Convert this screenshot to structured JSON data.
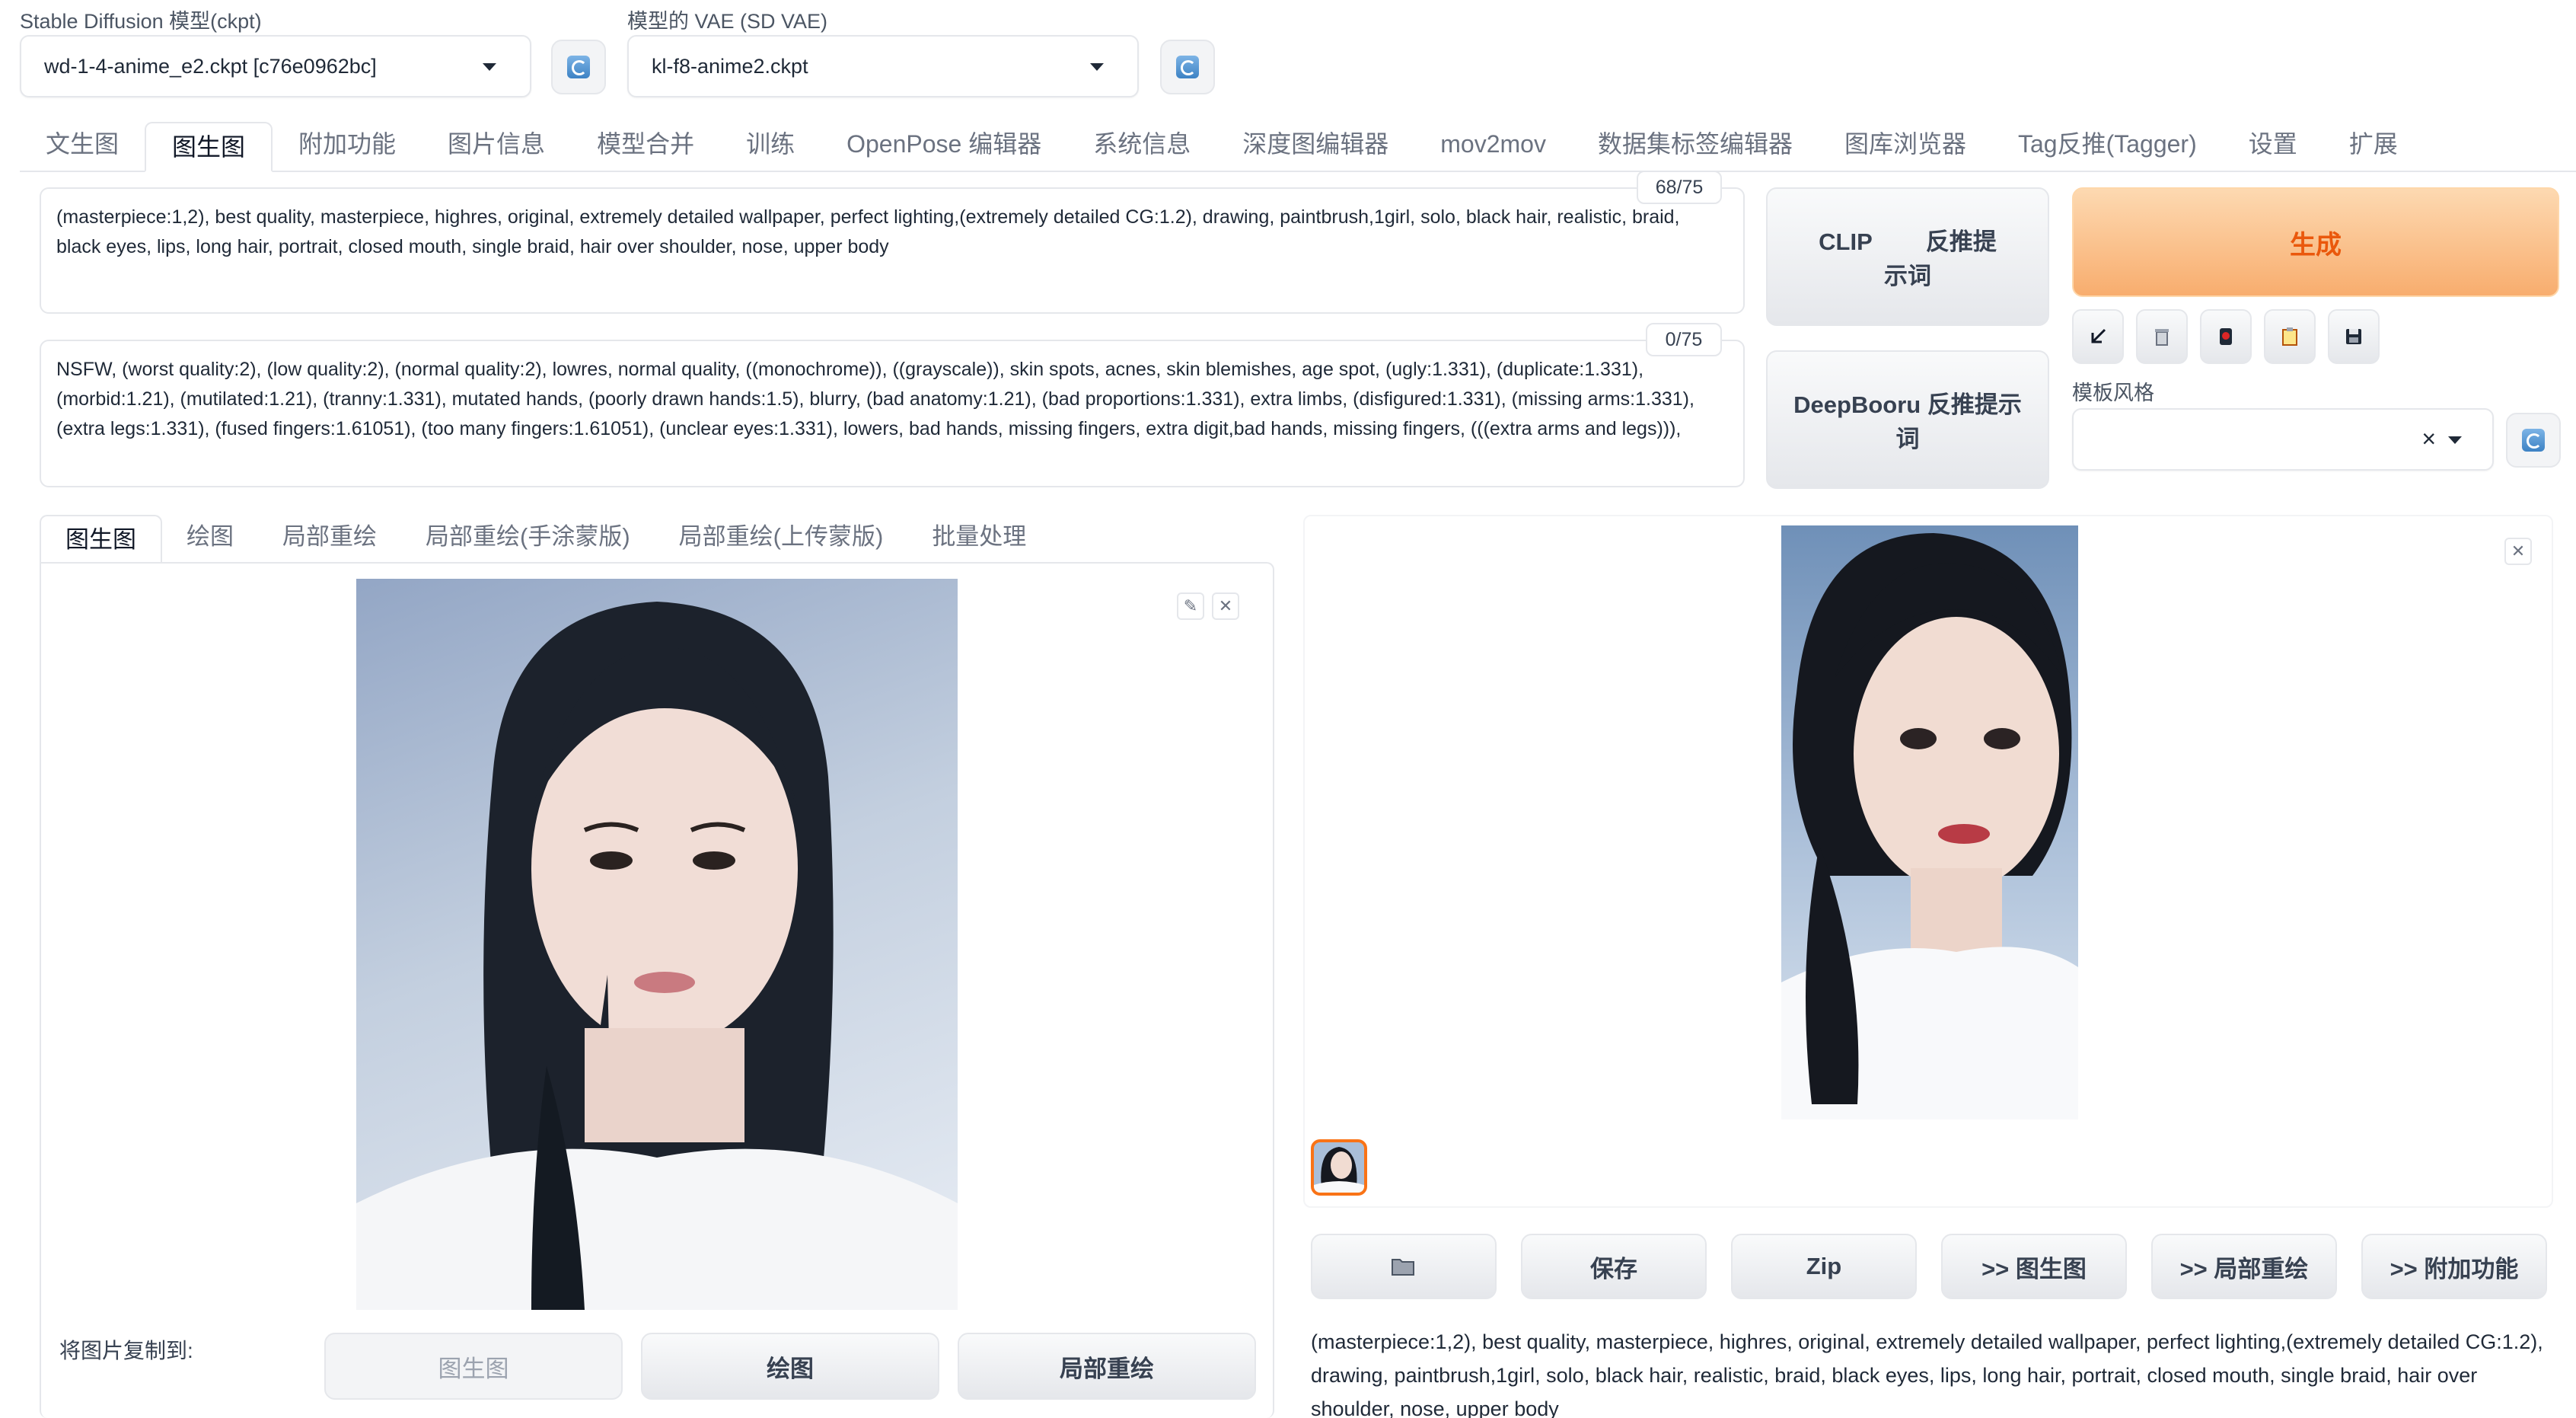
{
  "ckpt": {
    "label": "Stable Diffusion 模型(ckpt)",
    "value": "wd-1-4-anime_e2.ckpt [c76e0962bc]"
  },
  "vae": {
    "label": "模型的 VAE (SD VAE)",
    "value": "kl-f8-anime2.ckpt"
  },
  "tabs": [
    {
      "label": "文生图"
    },
    {
      "label": "图生图"
    },
    {
      "label": "附加功能"
    },
    {
      "label": "图片信息"
    },
    {
      "label": "模型合并"
    },
    {
      "label": "训练"
    },
    {
      "label": "OpenPose 编辑器"
    },
    {
      "label": "系统信息"
    },
    {
      "label": "深度图编辑器"
    },
    {
      "label": "mov2mov"
    },
    {
      "label": "数据集标签编辑器"
    },
    {
      "label": "图库浏览器"
    },
    {
      "label": "Tag反推(Tagger)"
    },
    {
      "label": "设置"
    },
    {
      "label": "扩展"
    }
  ],
  "active_tab": "图生图",
  "prompt": {
    "text": "(masterpiece:1,2), best quality, masterpiece, highres, original, extremely detailed wallpaper, perfect lighting,(extremely detailed CG:1.2), drawing, paintbrush,1girl, solo, black hair, realistic, braid, black eyes, lips, long hair, portrait, closed mouth, single braid, hair over shoulder, nose, upper body",
    "counter": "68/75"
  },
  "negative_prompt": {
    "text": "NSFW, (worst quality:2), (low quality:2), (normal quality:2), lowres, normal quality, ((monochrome)), ((grayscale)), skin spots, acnes, skin blemishes, age spot, (ugly:1.331), (duplicate:1.331), (morbid:1.21), (mutilated:1.21), (tranny:1.331), mutated hands, (poorly drawn hands:1.5), blurry, (bad anatomy:1.21), (bad proportions:1.331), extra limbs, (disfigured:1.331), (missing arms:1.331), (extra legs:1.331), (fused fingers:1.61051), (too many fingers:1.61051), (unclear eyes:1.331), lowers, bad hands, missing fingers, extra digit,bad hands, missing fingers, (((extra arms and legs))),",
    "counter": "0/75"
  },
  "interrogate": {
    "clip_line1": "CLIP 　　反推提",
    "clip_line2": "示词",
    "deepbooru_line1": "DeepBooru 反推提示",
    "deepbooru_line2": "词"
  },
  "generate_label": "生成",
  "styles_label": "模板风格",
  "style_clear": "×",
  "input_tabs": [
    {
      "label": "图生图"
    },
    {
      "label": "绘图"
    },
    {
      "label": "局部重绘"
    },
    {
      "label": "局部重绘(手涂蒙版)"
    },
    {
      "label": "局部重绘(上传蒙版)"
    },
    {
      "label": "批量处理"
    }
  ],
  "copy_to": {
    "label": "将图片复制到:",
    "buttons": [
      {
        "label": "图生图"
      },
      {
        "label": "绘图"
      },
      {
        "label": "局部重绘"
      }
    ]
  },
  "output_buttons": {
    "save": "保存",
    "zip": "Zip",
    "to_img2img": ">> 图生图",
    "to_inpaint": ">> 局部重绘",
    "to_extras": ">> 附加功能"
  },
  "output_info": "(masterpiece:1,2), best quality, masterpiece, highres, original, extremely detailed wallpaper, perfect lighting,(extremely detailed CG:1.2), drawing, paintbrush,1girl, solo, black hair, realistic, braid, black eyes, lips, long hair, portrait, closed mouth, single braid, hair over shoulder, nose, upper body",
  "icons": {
    "refresh": "refresh-icon",
    "close": "close-icon",
    "edit": "pencil-icon",
    "folder": "folder-icon",
    "arrow": "arrow-down-left-icon",
    "trash": "trash-icon",
    "card": "red-card-icon",
    "clipboard": "clipboard-icon",
    "save": "floppy-disk-icon"
  },
  "colors": {
    "accent": "#ea580c",
    "generate_bg": "#f8ad6e",
    "border": "#e5e7eb"
  }
}
